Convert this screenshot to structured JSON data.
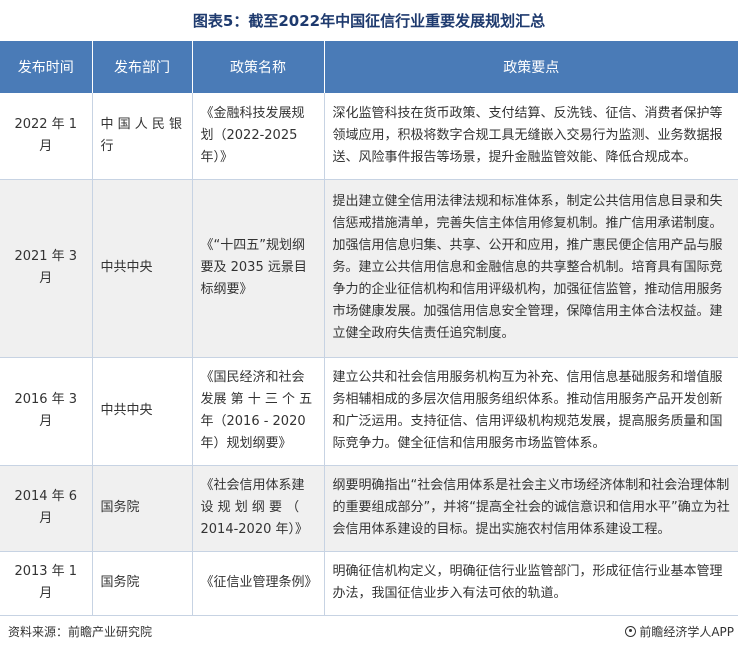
{
  "title": "图表5：截至2022年中国征信行业重要发展规划汇总",
  "table": {
    "headers": [
      "发布时间",
      "发布部门",
      "政策名称",
      "政策要点"
    ],
    "rows": [
      {
        "date": "2022 年 1 月",
        "dept": "中 国 人 民 银 行",
        "name": "《金融科技发展规划（2022-2025 年）》",
        "key": "深化监管科技在货币政策、支付结算、反洗钱、征信、消费者保护等领域应用，积极将数字合规工具无缝嵌入交易行为监测、业务数据报送、风险事件报告等场景，提升金融监管效能、降低合规成本。"
      },
      {
        "date": "2021 年 3 月",
        "dept": "中共中央",
        "name": "《“十四五”规划纲要及 2035 远景目标纲要》",
        "key": "提出建立健全信用法律法规和标准体系，制定公共信用信息目录和失信惩戒措施清单，完善失信主体信用修复机制。推广信用承诺制度。加强信用信息归集、共享、公开和应用，推广惠民便企信用产品与服务。建立公共信用信息和金融信息的共享整合机制。培育具有国际竞争力的企业征信机构和信用评级机构，加强征信监管，推动信用服务市场健康发展。加强信用信息安全管理，保障信用主体合法权益。建立健全政府失信责任追究制度。"
      },
      {
        "date": "2016 年 3 月",
        "dept": "中共中央",
        "name": "《国民经济和社会发展 第 十 三 个 五 年（2016 - 2020 年）规划纲要》",
        "key": "建立公共和社会信用服务机构互为补充、信用信息基础服务和增值服务相辅相成的多层次信用服务组织体系。推动信用服务产品开发创新和广泛运用。支持征信、信用评级机构规范发展，提高服务质量和国际竞争力。健全征信和信用服务市场监管体系。"
      },
      {
        "date": "2014 年 6 月",
        "dept": "国务院",
        "name": "《社会信用体系建设 规 划 纲 要 （ 2014-2020 年）》",
        "key": "纲要明确指出“社会信用体系是社会主义市场经济体制和社会治理体制的重要组成部分”，并将“提高全社会的诚信意识和信用水平”确立为社会信用体系建设的目标。提出实施农村信用体系建设工程。"
      },
      {
        "date": "2013 年 1 月",
        "dept": "国务院",
        "name": "《征信业管理条例》",
        "key": "明确征信机构定义，明确征信行业监管部门，形成征信行业基本管理办法，我国征信业步入有法可依的轨道。"
      }
    ]
  },
  "footer": {
    "source": "资料来源：前瞻产业研究院",
    "brand": "前瞻经济学人APP"
  }
}
